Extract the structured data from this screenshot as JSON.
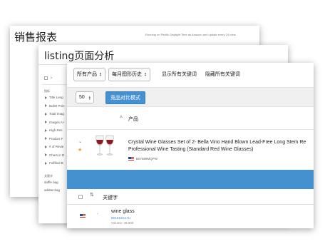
{
  "sales_window": {
    "title": "销售报表",
    "note": "Running on Pacific Daylight Time as Amazon and update every 24 mins"
  },
  "listing_window": {
    "title": "listing页面分析",
    "sidebar": {
      "group1_label": "指标",
      "items": [
        "Title Leng",
        "Bullet Poin",
        "Total Imag",
        "Images A+",
        "High Res",
        "Product F",
        "# of Revie",
        "Chars in D",
        "Fulfilled B"
      ],
      "group2_label": "关键字",
      "keywords": [
        "duffle bag",
        "adidas bag"
      ]
    }
  },
  "main_window": {
    "filters": {
      "all_products": "所有产品",
      "monthly_history": "每月图形历史",
      "show_keywords": "显示所有关键词",
      "hide_keywords": "隐藏所有关键词"
    },
    "page_size": "50",
    "compare_button": "竞品对比模式",
    "product_header": "产品",
    "product": {
      "title_line1": "Crystal Wine Glasses Set of 2- Bella Vino Hand Blown Lead-Free Long Stem Re",
      "title_line2": "Professional Wine Tasting (Standard Red Wine Glasses)",
      "asin": "B07689MQPW"
    },
    "keyword_header": "关键字",
    "keyword_row": {
      "dash": "-",
      "keyword": "wine glass",
      "asin": "B01816GJAU",
      "volume": "Volume: 49,500"
    }
  },
  "colors": {
    "accent_blue": "#4590cf",
    "star": "#f0a020",
    "wine_red": "#8b1a22"
  }
}
